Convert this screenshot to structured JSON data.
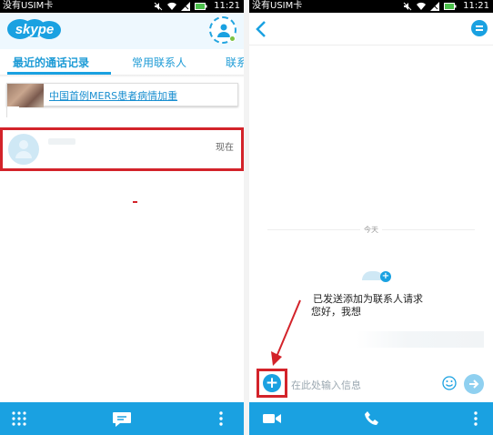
{
  "left": {
    "status": {
      "carrier": "没有USIM卡",
      "time": "11:21"
    },
    "header": {
      "logo_text": "skype"
    },
    "tabs": [
      {
        "label": "最近的通话记录",
        "active": true
      },
      {
        "label": "常用联系人",
        "active": false
      },
      {
        "label": "联系",
        "active": false
      }
    ],
    "news": {
      "text": "中国首例MERS患者病情加重"
    },
    "recent": {
      "time": "现在"
    },
    "icons": {
      "dialpad": "dialpad-icon",
      "chat": "chat-icon",
      "more": "more-vertical-icon"
    }
  },
  "right": {
    "status": {
      "carrier": "没有USIM卡",
      "time": "11:21"
    },
    "chat": {
      "day_label": "今天",
      "message_line1": "已发送添加为联系人请求",
      "message_line2": "您好，我想",
      "input_placeholder": "在此处输入信息"
    },
    "icons": {
      "back": "back-arrow-icon",
      "menu": "menu-icon",
      "add": "add-icon",
      "emoji": "emoji-icon",
      "send": "send-icon",
      "video": "video-call-icon",
      "call": "phone-call-icon",
      "more": "more-vertical-icon"
    }
  },
  "colors": {
    "skype_blue": "#1aa1e1",
    "highlight_red": "#d3232a",
    "status_bar": "#000000"
  }
}
